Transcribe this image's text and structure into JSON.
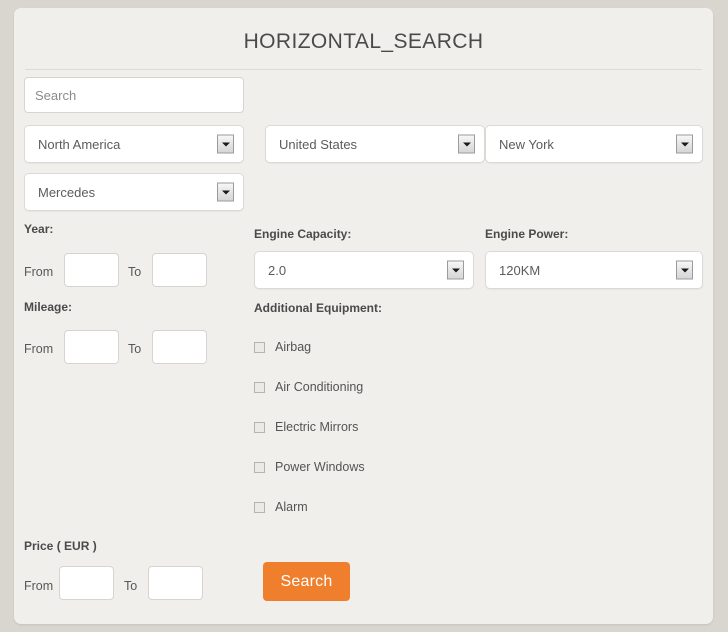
{
  "page": {
    "title": "HORIZONTAL_SEARCH",
    "background_color": "#d9d6cf",
    "panel_color": "#f1efec",
    "accent_color": "#f07f2d"
  },
  "search": {
    "placeholder": "Search",
    "value": ""
  },
  "selects": [
    {
      "name": "region",
      "value": "North America"
    },
    {
      "name": "country",
      "value": "United States"
    },
    {
      "name": "state",
      "value": "New York"
    },
    {
      "name": "make",
      "value": "Mercedes"
    }
  ],
  "year": {
    "label": "Year:",
    "from_label": "From",
    "to_label": "To",
    "from_value": "",
    "to_value": ""
  },
  "mileage": {
    "label": "Mileage:",
    "from_label": "From",
    "to_label": "To",
    "from_value": "",
    "to_value": ""
  },
  "price": {
    "label": "Price ( EUR )",
    "from_label": "From",
    "to_label": "To",
    "from_value": "",
    "to_value": ""
  },
  "engine_capacity": {
    "label": "Engine Capacity:",
    "value": "2.0"
  },
  "engine_power": {
    "label": "Engine Power:",
    "value": "120KM"
  },
  "additional_equipment": {
    "label": "Additional Equipment:",
    "items": [
      {
        "label": "Airbag",
        "checked": false
      },
      {
        "label": "Air Conditioning",
        "checked": false
      },
      {
        "label": "Electric Mirrors",
        "checked": false
      },
      {
        "label": "Power Windows",
        "checked": false
      },
      {
        "label": "Alarm",
        "checked": false
      }
    ]
  },
  "actions": {
    "search_label": "Search"
  }
}
